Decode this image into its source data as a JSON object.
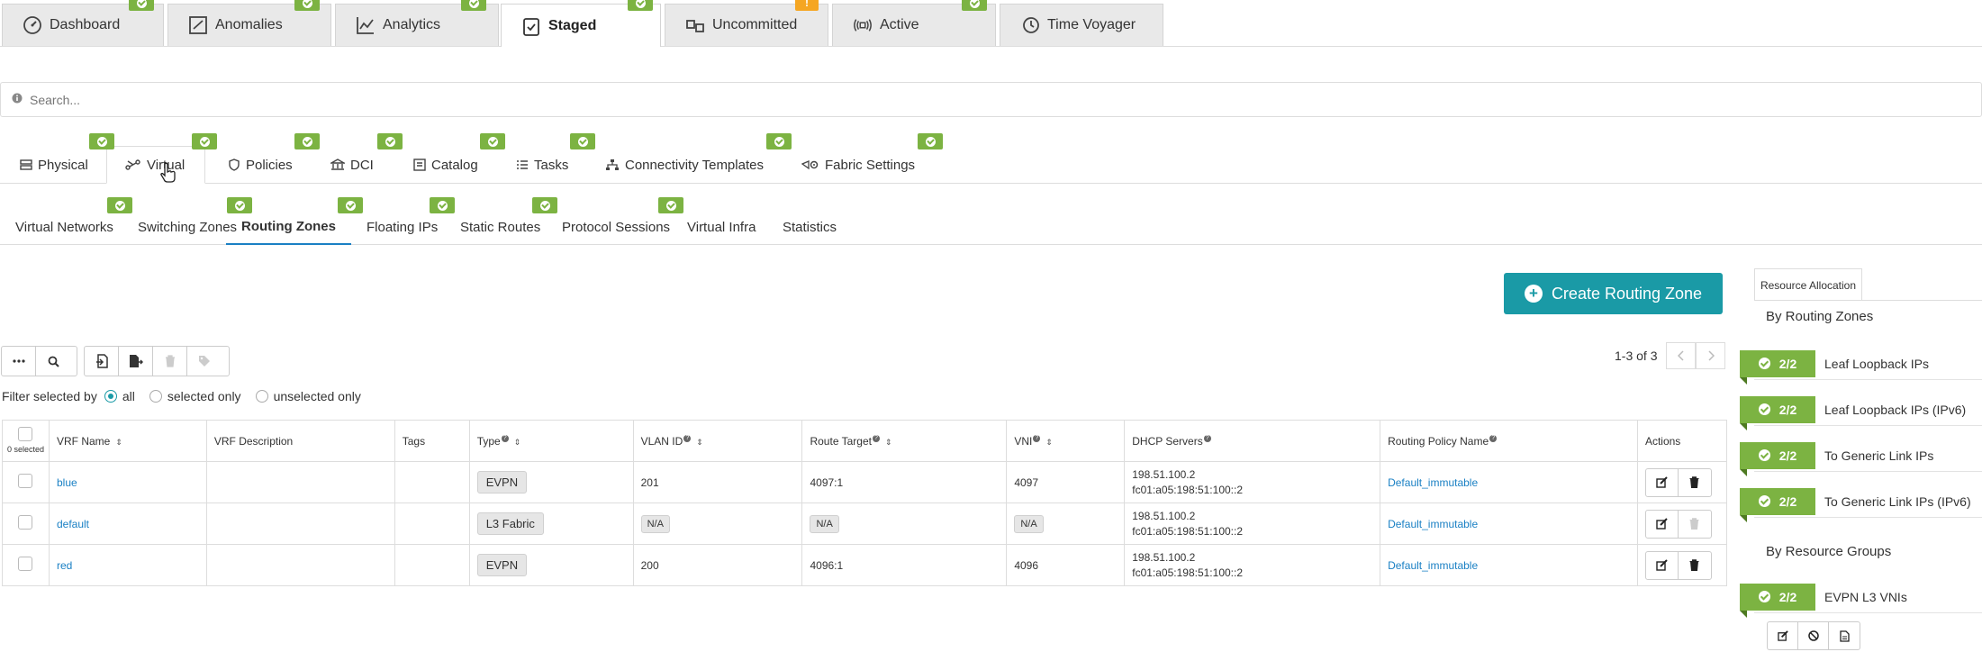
{
  "top_tabs": [
    {
      "label": "Dashboard",
      "icon": "gauge-icon"
    },
    {
      "label": "Anomalies",
      "icon": "anomaly-icon"
    },
    {
      "label": "Analytics",
      "icon": "chart-line-icon"
    },
    {
      "label": "Staged",
      "icon": "staged-icon"
    },
    {
      "label": "Uncommitted",
      "icon": "uncommitted-icon",
      "badge": "!"
    },
    {
      "label": "Active",
      "icon": "broadcast-icon"
    },
    {
      "label": "Time Voyager",
      "icon": "history-icon"
    }
  ],
  "search": {
    "placeholder": "Search..."
  },
  "section_tabs": [
    {
      "label": "Physical"
    },
    {
      "label": "Virtual"
    },
    {
      "label": "Policies"
    },
    {
      "label": "DCI"
    },
    {
      "label": "Catalog"
    },
    {
      "label": "Tasks"
    },
    {
      "label": "Connectivity Templates"
    },
    {
      "label": "Fabric Settings"
    }
  ],
  "virtual_tabs": [
    {
      "label": "Virtual Networks"
    },
    {
      "label": "Switching Zones"
    },
    {
      "label": "Routing Zones"
    },
    {
      "label": "Floating IPs"
    },
    {
      "label": "Static Routes"
    },
    {
      "label": "Protocol Sessions"
    },
    {
      "label": "Virtual Infra"
    },
    {
      "label": "Statistics"
    }
  ],
  "create_button": {
    "label": "Create Routing Zone"
  },
  "pager": {
    "text": "1-3 of 3"
  },
  "filter": {
    "label": "Filter selected by",
    "opt_all": "all",
    "opt_selected": "selected only",
    "opt_unselected": "unselected only"
  },
  "table": {
    "selected_count": "0 selected",
    "headers": [
      "VRF Name",
      "VRF Description",
      "Tags",
      "Type",
      "VLAN ID",
      "Route Target",
      "VNI",
      "DHCP Servers",
      "Routing Policy Name",
      "Actions"
    ],
    "rows": [
      {
        "name": "blue",
        "type": "EVPN",
        "vlan": "201",
        "rt": "4097:1",
        "vni": "4097",
        "dhcp1": "198.51.100.2",
        "dhcp2": "fc01:a05:198:51:100::2",
        "policy": "Default_immutable"
      },
      {
        "name": "default",
        "type": "L3 Fabric",
        "vlan": "N/A",
        "rt": "N/A",
        "vni": "N/A",
        "dhcp1": "198.51.100.2",
        "dhcp2": "fc01:a05:198:51:100::2",
        "policy": "Default_immutable"
      },
      {
        "name": "red",
        "type": "EVPN",
        "vlan": "200",
        "rt": "4096:1",
        "vni": "4096",
        "dhcp1": "198.51.100.2",
        "dhcp2": "fc01:a05:198:51:100::2",
        "policy": "Default_immutable"
      }
    ]
  },
  "sidebar": {
    "tab": "Resource Allocation",
    "by_routing_zones": "By Routing Zones",
    "by_resource_groups": "By Resource Groups",
    "items": [
      {
        "count": "2/2",
        "label": "Leaf Loopback IPs"
      },
      {
        "count": "2/2",
        "label": "Leaf Loopback IPs (IPv6)"
      },
      {
        "count": "2/2",
        "label": "To Generic Link IPs"
      },
      {
        "count": "2/2",
        "label": "To Generic Link IPs (IPv6)"
      }
    ],
    "groups": [
      {
        "count": "2/2",
        "label": "EVPN L3 VNIs"
      }
    ]
  },
  "colors": {
    "accent": "#1a9aa6",
    "ok": "#7cb342",
    "warn": "#f5a623",
    "link": "#1a80c4"
  }
}
